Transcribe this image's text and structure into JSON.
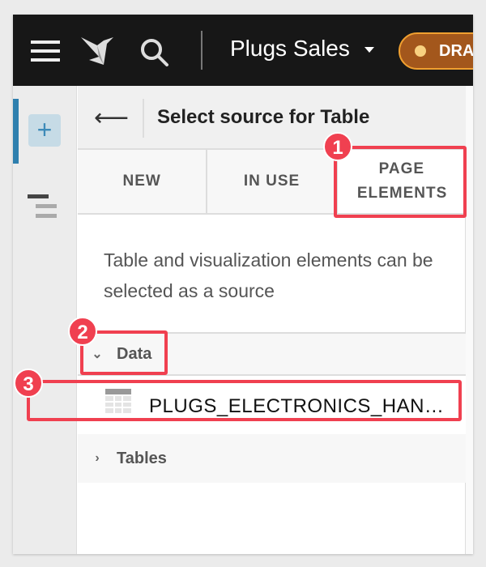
{
  "header": {
    "title": "Plugs Sales",
    "status": "DRAFT"
  },
  "panel": {
    "title": "Select source for Table",
    "tabs": [
      {
        "label": "NEW"
      },
      {
        "label": "IN USE"
      },
      {
        "label": "PAGE ELEMENTS"
      }
    ],
    "description": "Table and visualization elements can be selected as a source",
    "sections": [
      {
        "label": "Data",
        "expanded": true,
        "items": [
          {
            "label": "PLUGS_ELECTRONICS_HAN…"
          }
        ]
      },
      {
        "label": "Tables",
        "expanded": false
      }
    ]
  },
  "annotations": [
    "1",
    "2",
    "3"
  ],
  "colors": {
    "accent": "#2e7fae",
    "annotation": "#f04050",
    "draft": "#a3571c"
  }
}
